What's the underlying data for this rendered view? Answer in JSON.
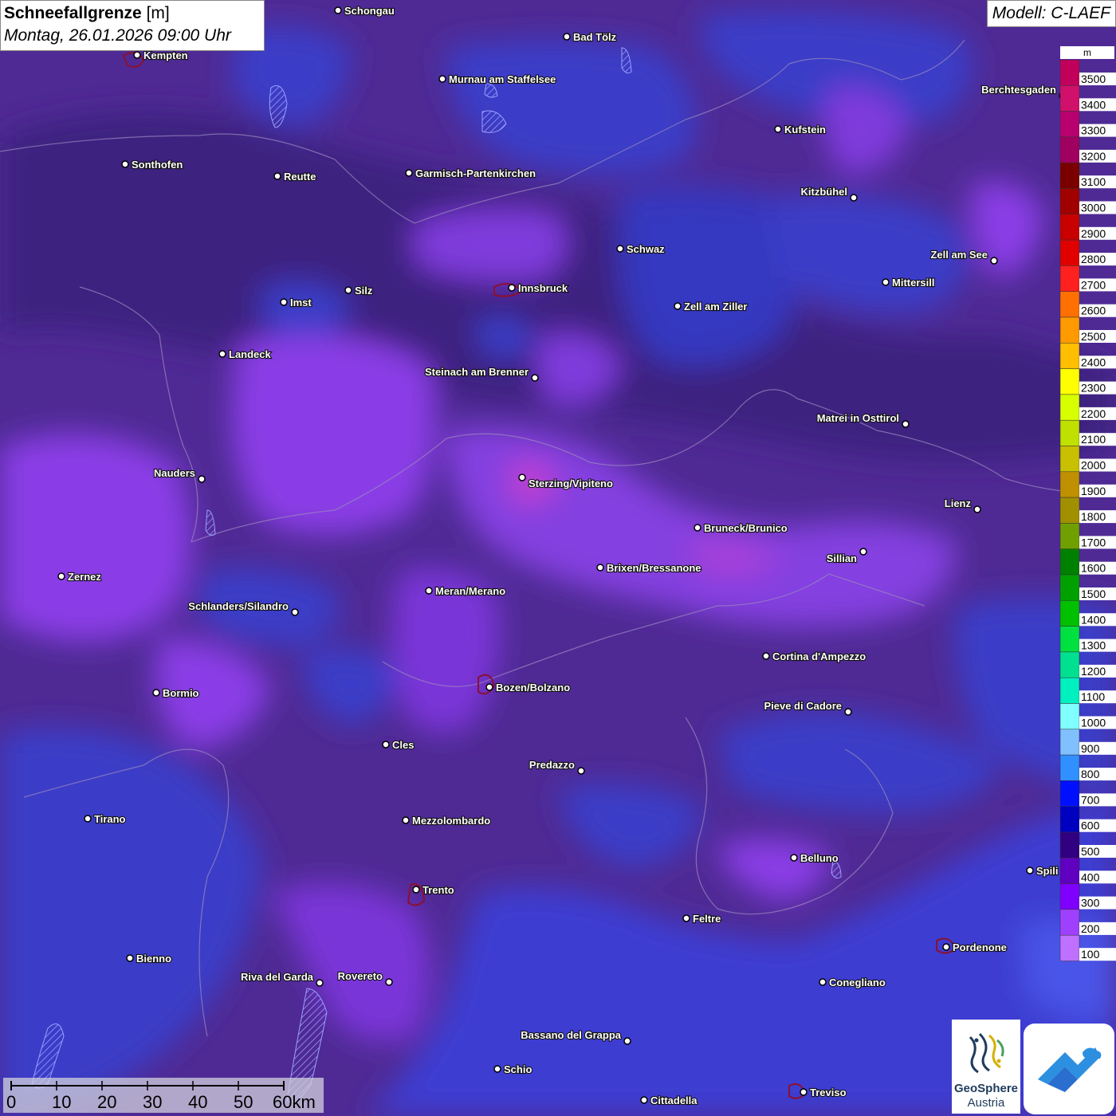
{
  "title": {
    "parameter": "Schneefallgrenze",
    "unit": "[m]",
    "datetime": "Montag, 26.01.2026 09:00 Uhr"
  },
  "model": "Modell: C-LAEF",
  "legend": {
    "unit": "m",
    "levels": [
      {
        "value": "3500",
        "color": "#c0005a"
      },
      {
        "value": "3400",
        "color": "#d0106a"
      },
      {
        "value": "3300",
        "color": "#b8006e"
      },
      {
        "value": "3200",
        "color": "#a00060"
      },
      {
        "value": "3100",
        "color": "#7a0000"
      },
      {
        "value": "3000",
        "color": "#a00000"
      },
      {
        "value": "2900",
        "color": "#c80000"
      },
      {
        "value": "2800",
        "color": "#e00000"
      },
      {
        "value": "2700",
        "color": "#ff2020"
      },
      {
        "value": "2600",
        "color": "#ff7000"
      },
      {
        "value": "2500",
        "color": "#ff9a00"
      },
      {
        "value": "2400",
        "color": "#ffbe00"
      },
      {
        "value": "2300",
        "color": "#ffff00"
      },
      {
        "value": "2200",
        "color": "#d8ff00"
      },
      {
        "value": "2100",
        "color": "#c0e000"
      },
      {
        "value": "2000",
        "color": "#c8c000"
      },
      {
        "value": "1900",
        "color": "#c09000"
      },
      {
        "value": "1800",
        "color": "#a09000"
      },
      {
        "value": "1700",
        "color": "#70a000"
      },
      {
        "value": "1600",
        "color": "#008000"
      },
      {
        "value": "1500",
        "color": "#00a000"
      },
      {
        "value": "1400",
        "color": "#00c000"
      },
      {
        "value": "1300",
        "color": "#00e040"
      },
      {
        "value": "1200",
        "color": "#00e090"
      },
      {
        "value": "1100",
        "color": "#00f0c0"
      },
      {
        "value": "1000",
        "color": "#80ffff"
      },
      {
        "value": "900",
        "color": "#80c0ff"
      },
      {
        "value": "800",
        "color": "#3090ff"
      },
      {
        "value": "700",
        "color": "#0010ff"
      },
      {
        "value": "600",
        "color": "#0000c0"
      },
      {
        "value": "500",
        "color": "#300080"
      },
      {
        "value": "400",
        "color": "#6000c0"
      },
      {
        "value": "300",
        "color": "#8000ff"
      },
      {
        "value": "200",
        "color": "#a040ff"
      },
      {
        "value": "100",
        "color": "#c070ff"
      }
    ]
  },
  "cities": [
    {
      "name": "Schongau"
    },
    {
      "name": "Bad Tölz"
    },
    {
      "name": "Kempten"
    },
    {
      "name": "Murnau am Staffelsee"
    },
    {
      "name": "Berchtesgaden"
    },
    {
      "name": "Kufstein"
    },
    {
      "name": "Sonthofen"
    },
    {
      "name": "Reutte"
    },
    {
      "name": "Garmisch-Partenkirchen"
    },
    {
      "name": "Kitzbühel"
    },
    {
      "name": "Schwaz"
    },
    {
      "name": "Zell am See"
    },
    {
      "name": "Mittersill"
    },
    {
      "name": "Innsbruck"
    },
    {
      "name": "Imst"
    },
    {
      "name": "Silz"
    },
    {
      "name": "Zell am Ziller"
    },
    {
      "name": "Landeck"
    },
    {
      "name": "Steinach am Brenner"
    },
    {
      "name": "Matrei in Osttirol"
    },
    {
      "name": "Nauders"
    },
    {
      "name": "Sterzing/Vipiteno"
    },
    {
      "name": "Lienz"
    },
    {
      "name": "Bruneck/Brunico"
    },
    {
      "name": "Sillian"
    },
    {
      "name": "Zernez"
    },
    {
      "name": "Brixen/Bressanone"
    },
    {
      "name": "Meran/Merano"
    },
    {
      "name": "Schlanders/Silandro"
    },
    {
      "name": "Cortina d'Ampezzo"
    },
    {
      "name": "Bozen/Bolzano"
    },
    {
      "name": "Bormio"
    },
    {
      "name": "Pieve di Cadore"
    },
    {
      "name": "Cles"
    },
    {
      "name": "Predazzo"
    },
    {
      "name": "Tirano"
    },
    {
      "name": "Mezzolombardo"
    },
    {
      "name": "Belluno"
    },
    {
      "name": "Spili"
    },
    {
      "name": "Trento"
    },
    {
      "name": "Feltre"
    },
    {
      "name": "Pordenone"
    },
    {
      "name": "Bienno"
    },
    {
      "name": "Riva del Garda"
    },
    {
      "name": "Rovereto"
    },
    {
      "name": "Conegliano"
    },
    {
      "name": "Bassano del Grappa"
    },
    {
      "name": "Schio"
    },
    {
      "name": "Treviso"
    },
    {
      "name": "Cittadella"
    }
  ],
  "scale_bar": {
    "labels": [
      "0",
      "10",
      "20",
      "30",
      "40",
      "50",
      "60km"
    ]
  },
  "logo": {
    "name_line1": "GeoSphere",
    "name_line2": "Austria"
  }
}
